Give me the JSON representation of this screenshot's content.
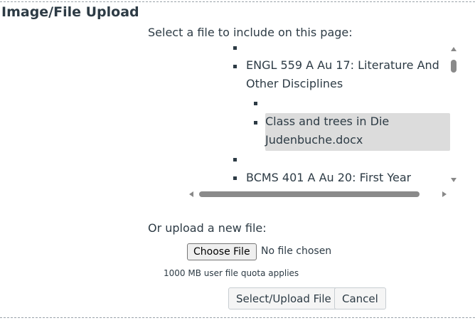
{
  "section": {
    "title": "Image/File Upload"
  },
  "select_prompt": "Select a file to include on this page:",
  "tree": {
    "items": [
      {
        "label_line1": "ENGL 559 A Au 17: Literature And",
        "label_line2": "Other Disciplines"
      },
      {
        "label_line1": "Class and trees in Die",
        "label_line2": "Judenbuche.docx",
        "selected": true
      },
      {
        "label_line1": "BCMS 401 A Au 20: First Year"
      }
    ]
  },
  "upload": {
    "prompt": "Or upload a new file:",
    "choose_label": "Choose File",
    "no_file_text": "No file chosen",
    "quota_text": "1000 MB user file quota applies"
  },
  "actions": {
    "submit_label": "Select/Upload File",
    "cancel_label": "Cancel"
  }
}
